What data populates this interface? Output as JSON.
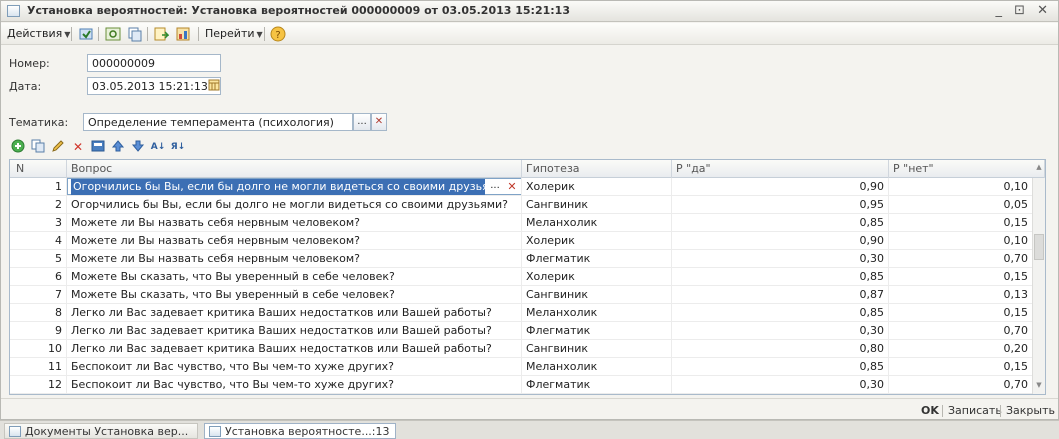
{
  "window": {
    "title": "Установка вероятностей: Установка вероятностей 000000009 от 03.05.2013 15:21:13",
    "controls": "_ ⊡ ✕"
  },
  "toolbar": {
    "actions_label": "Действия",
    "goto_label": "Перейти",
    "help_icon": "help-icon"
  },
  "form": {
    "number_label": "Номер:",
    "number_value": "000000009",
    "date_label": "Дата:",
    "date_value": "03.05.2013 15:21:13",
    "topic_label": "Тематика:",
    "topic_value": "Определение темперамента (психология)",
    "topic_select": "...",
    "topic_clear": "✕"
  },
  "grid": {
    "columns": [
      "N",
      "Вопрос",
      "Гипотеза",
      "P \"да\"",
      "P \"нет\""
    ],
    "selected_edit_btn": "...",
    "selected_clear_btn": "✕",
    "rows": [
      {
        "n": "1",
        "q": "Огорчились бы Вы, если бы долго не могли видеться со своими друзьями?",
        "h": "Холерик",
        "yes": "0,90",
        "no": "0,10"
      },
      {
        "n": "2",
        "q": "Огорчились бы Вы, если бы долго не могли видеться со своими друзьями?",
        "h": "Сангвиник",
        "yes": "0,95",
        "no": "0,05"
      },
      {
        "n": "3",
        "q": "Можете ли Вы назвать себя нервным человеком?",
        "h": "Меланхолик",
        "yes": "0,85",
        "no": "0,15"
      },
      {
        "n": "4",
        "q": "Можете ли Вы назвать себя нервным человеком?",
        "h": "Холерик",
        "yes": "0,90",
        "no": "0,10"
      },
      {
        "n": "5",
        "q": "Можете ли Вы назвать себя нервным человеком?",
        "h": "Флегматик",
        "yes": "0,30",
        "no": "0,70"
      },
      {
        "n": "6",
        "q": "Можете Вы сказать, что Вы уверенный в себе человек?",
        "h": "Холерик",
        "yes": "0,85",
        "no": "0,15"
      },
      {
        "n": "7",
        "q": "Можете Вы сказать, что Вы уверенный в себе человек?",
        "h": "Сангвиник",
        "yes": "0,87",
        "no": "0,13"
      },
      {
        "n": "8",
        "q": "Легко ли Вас задевает критика Ваших недостатков или Вашей работы?",
        "h": "Меланхолик",
        "yes": "0,85",
        "no": "0,15"
      },
      {
        "n": "9",
        "q": "Легко ли Вас задевает критика Ваших недостатков или Вашей работы?",
        "h": "Флегматик",
        "yes": "0,30",
        "no": "0,70"
      },
      {
        "n": "10",
        "q": "Легко ли Вас задевает критика Ваших недостатков или Вашей работы?",
        "h": "Сангвиник",
        "yes": "0,80",
        "no": "0,20"
      },
      {
        "n": "11",
        "q": "Беспокоит ли Вас чувство, что Вы чем-то хуже других?",
        "h": "Меланхолик",
        "yes": "0,85",
        "no": "0,15"
      },
      {
        "n": "12",
        "q": "Беспокоит ли Вас чувство, что Вы чем-то хуже других?",
        "h": "Флегматик",
        "yes": "0,30",
        "no": "0,70"
      }
    ]
  },
  "footer": {
    "ok_label": "OK",
    "save_label": "Записать",
    "close_label": "Закрыть"
  },
  "taskbar": {
    "items": [
      "Документы Установка вер...",
      "Установка вероятносте...:13"
    ]
  },
  "colors": {
    "selection": "#3c6fb4",
    "grid_border": "#a9bacb"
  }
}
